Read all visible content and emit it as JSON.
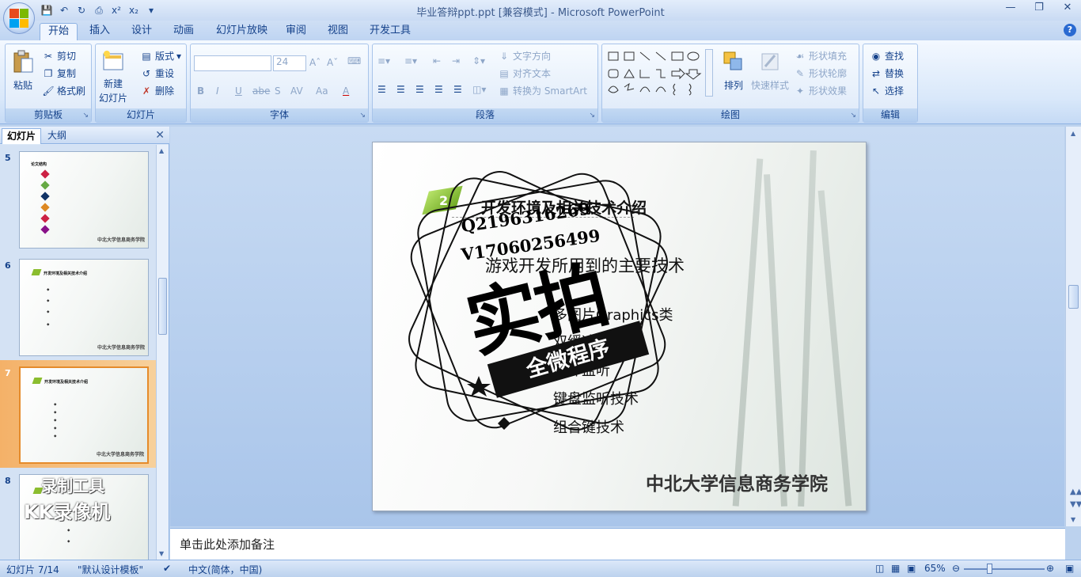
{
  "window": {
    "title": "毕业答辩ppt.ppt [兼容模式] - Microsoft PowerPoint"
  },
  "ribbon_tabs": [
    "开始",
    "插入",
    "设计",
    "动画",
    "幻灯片放映",
    "审阅",
    "视图",
    "开发工具"
  ],
  "groups": {
    "clipboard": {
      "label": "剪贴板",
      "paste": "粘贴",
      "cut": "剪切",
      "copy": "复制",
      "format_painter": "格式刷"
    },
    "slides": {
      "label": "幻灯片",
      "new_slide_1": "新建",
      "new_slide_2": "幻灯片",
      "layout": "版式",
      "reset": "重设",
      "delete": "删除"
    },
    "font": {
      "label": "字体",
      "font_size": "24",
      "bold": "B",
      "italic": "I",
      "underline": "U",
      "strike": "abe",
      "shadow": "S",
      "spacing": "AV",
      "case": "Aa",
      "color": "A"
    },
    "paragraph": {
      "label": "段落",
      "text_direction": "文字方向",
      "align_text": "对齐文本",
      "smartart": "转换为 SmartArt"
    },
    "drawing": {
      "label": "绘图",
      "arrange": "排列",
      "quick_styles": "快速样式",
      "shape_fill": "形状填充",
      "shape_outline": "形状轮廓",
      "shape_effects": "形状效果"
    },
    "editing": {
      "label": "编辑",
      "find": "查找",
      "replace": "替换",
      "select": "选择"
    }
  },
  "left_pane": {
    "tab_slides": "幻灯片",
    "tab_outline": "大纲",
    "thumbnails": [
      {
        "num": "5",
        "title": "论文结构",
        "footer": "中北大学信息商务学院"
      },
      {
        "num": "6",
        "title": "开发环境及相关技术介绍",
        "footer": "中北大学信息商务学院"
      },
      {
        "num": "7",
        "title": "开发环境及相关技术介绍",
        "footer": "中北大学信息商务学院"
      },
      {
        "num": "8",
        "title": "",
        "footer": ""
      }
    ]
  },
  "slide": {
    "number_badge": "2",
    "title": "开发环境及相关技术介绍",
    "subtitle": "游戏开发所用到的主要技术",
    "items": [
      "多图片Graphics类",
      "双缓冲技术",
      "事件监听",
      "键盘监听技术",
      "组合键技术"
    ],
    "footer": "中北大学信息商务学院"
  },
  "watermark": {
    "phone1": "Q2196316269",
    "phone2": "V17060256499",
    "big_text": "实拍",
    "ribbon_text": "全微程序",
    "recorder_l1": "录制工具",
    "recorder_l2": "KK录像机"
  },
  "notes": {
    "placeholder": "单击此处添加备注"
  },
  "status": {
    "slide_pos": "幻灯片 7/14",
    "theme": "\"默认设计模板\"",
    "language": "中文(简体，中国)",
    "zoom": "65%"
  },
  "colors": {
    "ribbon_bg": "#dbe7f8",
    "accent": "#15428b",
    "selected_thumb": "#f4b168"
  }
}
